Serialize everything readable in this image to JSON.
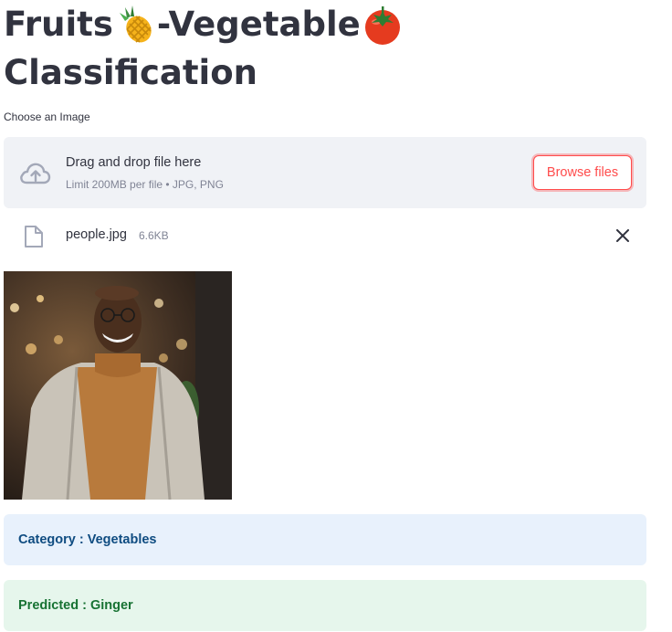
{
  "header": {
    "title_part1": "Fruits",
    "title_part2": "-Vegetable",
    "title_line2": "Classification",
    "emoji_1": "pineapple-icon",
    "emoji_2": "tomato-icon"
  },
  "uploader": {
    "label": "Choose an Image",
    "dropzone_title": "Drag and drop file here",
    "dropzone_limit": "Limit 200MB per file • JPG, PNG",
    "browse_label": "Browse files",
    "icon": "cloud-upload-icon"
  },
  "file": {
    "name": "people.jpg",
    "size": "6.6KB",
    "icon": "file-icon",
    "remove_icon": "close-icon"
  },
  "results": {
    "category": "Category : Vegetables",
    "predicted": "Predicted : Ginger"
  },
  "colors": {
    "text": "#31333f",
    "accent": "#ff4b4b",
    "info_bg": "#e8f1fc",
    "info_text": "#0f4c81",
    "success_bg": "#e6f6ec",
    "success_text": "#177233",
    "dropzone_bg": "#f0f2f6"
  }
}
